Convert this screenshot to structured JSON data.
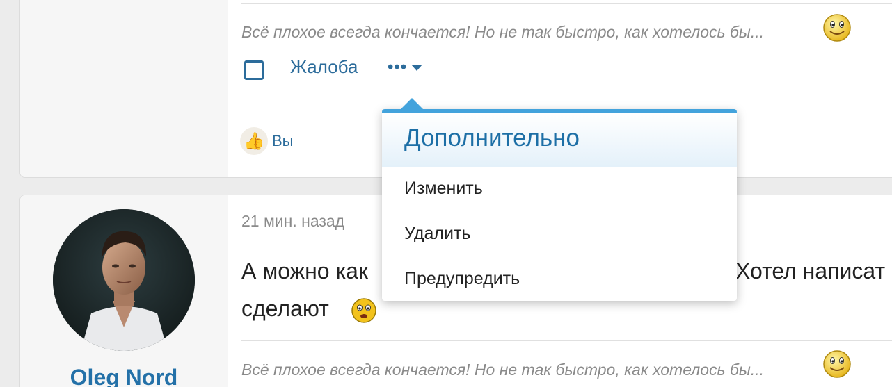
{
  "post1": {
    "signature": "Всё плохое всегда кончается! Но не так быстро, как хотелось бы...",
    "signature_icon": "smiley-icon",
    "actions": {
      "report_label": "Жалоба",
      "more_label": "•••"
    },
    "reaction": {
      "icon": "thumbs-up-icon",
      "who": "Вы"
    }
  },
  "post2": {
    "author": "Oleg Nord",
    "timestamp": "21 мин. назад",
    "body_start": "А можно как",
    "body_tail": "Хотел написат",
    "body_line2": "сделают",
    "emoticon": "worried-smiley-icon",
    "signature": "Всё плохое всегда кончается! Но не так быстро, как хотелось бы...",
    "signature_icon": "smiley-icon"
  },
  "dropdown": {
    "title": "Дополнительно",
    "items": [
      "Изменить",
      "Удалить",
      "Предупредить"
    ]
  },
  "colors": {
    "accent": "#2c6c9b",
    "menu_border": "#43a3dc",
    "username": "#2471a8"
  }
}
